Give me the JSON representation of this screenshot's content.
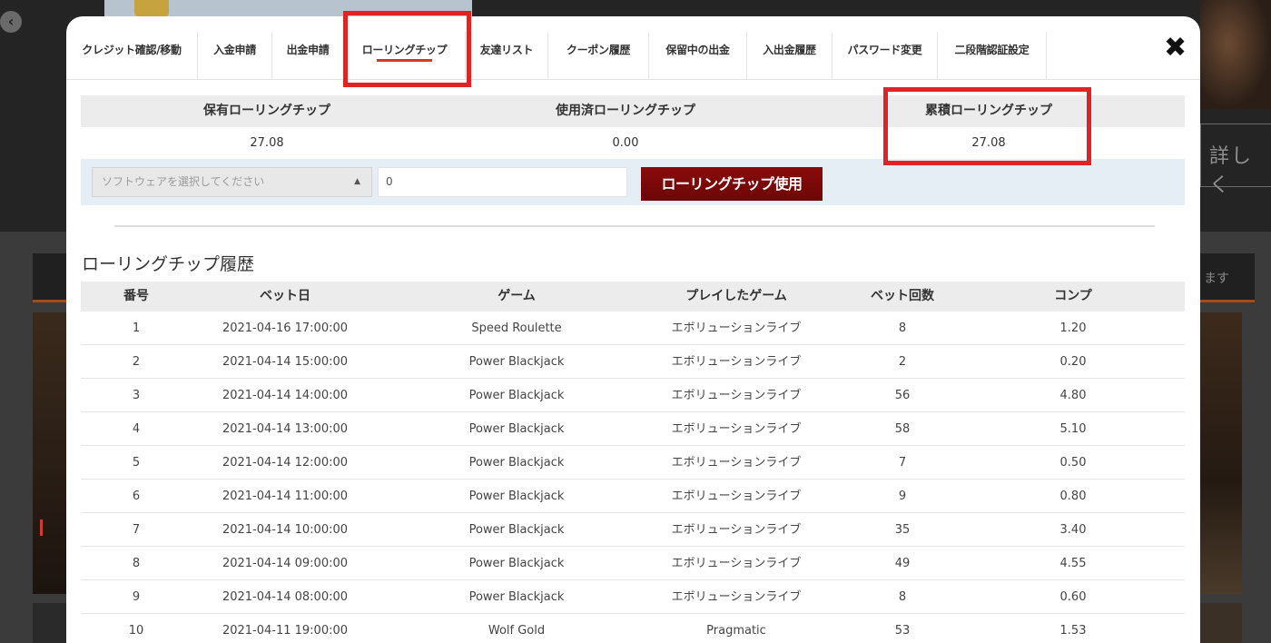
{
  "background": {
    "nav_arrow": "‹",
    "right_button_text": "詳しく",
    "right_tab_text": "ます"
  },
  "modal": {
    "close_icon": "✖",
    "tabs": [
      {
        "label": "クレジット確認/移動",
        "active": false
      },
      {
        "label": "入金申請",
        "active": false
      },
      {
        "label": "出金申請",
        "active": false
      },
      {
        "label": "ローリングチップ",
        "active": true
      },
      {
        "label": "友達リスト",
        "active": false
      },
      {
        "label": "クーポン履歴",
        "active": false
      },
      {
        "label": "保留中の出金",
        "active": false
      },
      {
        "label": "入出金履歴",
        "active": false
      },
      {
        "label": "パスワード変更",
        "active": false
      },
      {
        "label": "二段階認証設定",
        "active": false
      }
    ],
    "summary": {
      "held_label": "保有ローリングチップ",
      "held_value": "27.08",
      "used_label": "使用済ローリングチップ",
      "used_value": "0.00",
      "total_label": "累積ローリングチップ",
      "total_value": "27.08"
    },
    "controls": {
      "software_placeholder": "ソフトウェアを選択してください",
      "select_caret": "▲",
      "amount_value": "0",
      "use_button": "ローリングチップ使用"
    },
    "history": {
      "title": "ローリングチップ履歴",
      "columns": [
        "番号",
        "ベット日",
        "ゲーム",
        "プレイしたゲーム",
        "ベット回数",
        "コンプ"
      ],
      "rows": [
        [
          "1",
          "2021-04-16 17:00:00",
          "Speed Roulette",
          "エボリューションライブ",
          "8",
          "1.20"
        ],
        [
          "2",
          "2021-04-14 15:00:00",
          "Power Blackjack",
          "エボリューションライブ",
          "2",
          "0.20"
        ],
        [
          "3",
          "2021-04-14 14:00:00",
          "Power Blackjack",
          "エボリューションライブ",
          "56",
          "4.80"
        ],
        [
          "4",
          "2021-04-14 13:00:00",
          "Power Blackjack",
          "エボリューションライブ",
          "58",
          "5.10"
        ],
        [
          "5",
          "2021-04-14 12:00:00",
          "Power Blackjack",
          "エボリューションライブ",
          "7",
          "0.50"
        ],
        [
          "6",
          "2021-04-14 11:00:00",
          "Power Blackjack",
          "エボリューションライブ",
          "9",
          "0.80"
        ],
        [
          "7",
          "2021-04-14 10:00:00",
          "Power Blackjack",
          "エボリューションライブ",
          "35",
          "3.40"
        ],
        [
          "8",
          "2021-04-14 09:00:00",
          "Power Blackjack",
          "エボリューションライブ",
          "49",
          "4.55"
        ],
        [
          "9",
          "2021-04-14 08:00:00",
          "Power Blackjack",
          "エボリューションライブ",
          "8",
          "0.60"
        ],
        [
          "10",
          "2021-04-11 19:00:00",
          "Wolf Gold",
          "Pragmatic",
          "53",
          "1.53"
        ]
      ]
    }
  },
  "colors": {
    "highlight": "#e02424",
    "active_tab_underline": "#d9391c",
    "use_button": "#7a0808"
  }
}
